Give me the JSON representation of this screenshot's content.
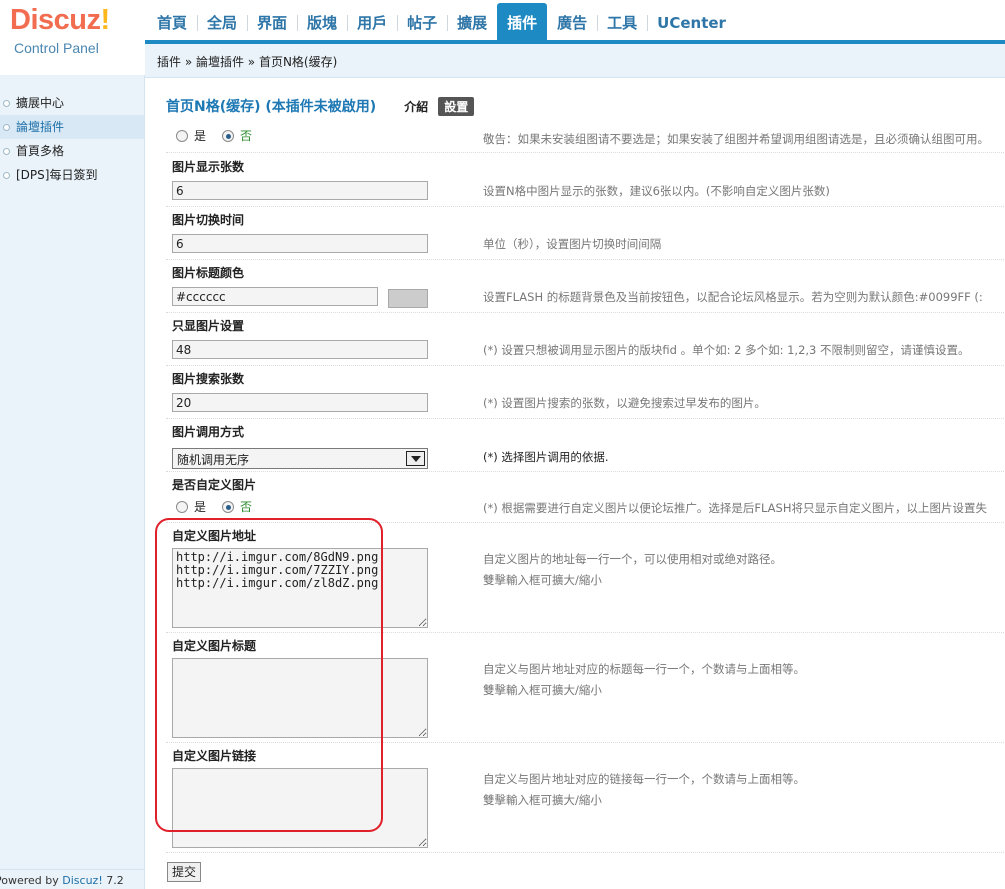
{
  "header": {
    "logo_text": "Discuz",
    "logo_bang": "!",
    "logo_sub": "Control Panel",
    "nav": [
      "首頁",
      "全局",
      "界面",
      "版塊",
      "用戶",
      "帖子",
      "擴展",
      "插件",
      "廣告",
      "工具",
      "UCenter"
    ],
    "active_nav": "插件",
    "breadcrumb": "插件 » 論壇插件 » 首页N格(缓存)"
  },
  "sidebar": {
    "items": [
      "擴展中心",
      "論壇插件",
      "首頁多格",
      "[DPS]每日簽到"
    ],
    "active": "論壇插件",
    "powered_prefix": "Powered by ",
    "powered_brand": "Discuz!",
    "powered_version": " 7.2"
  },
  "main": {
    "title": "首页N格(缓存) (本插件未被啟用)",
    "intro_label": "介紹",
    "settings_label": "設置",
    "top_row": {
      "opt_yes": "是",
      "opt_no": "否",
      "desc": "敬告：如果未安装组图请不要选是；如果安装了组图并希望调用组图请选是，且必须确认组图可用。"
    },
    "fields": [
      {
        "label": "图片显示张数",
        "value": "6",
        "desc": "设置N格中图片显示的张数，建议6张以内。(不影响自定义图片张数)"
      },
      {
        "label": "图片切换时间",
        "value": "6",
        "desc": "单位（秒），设置图片切换时间间隔"
      },
      {
        "label": "图片标题颜色",
        "value": "#cccccc",
        "swatch": "#cccccc",
        "desc": "设置FLASH 的标题背景色及当前按钮色，以配合论坛风格显示。若为空则为默认颜色:#0099FF (:"
      },
      {
        "label": "只显图片设置",
        "value": "48",
        "desc": "(*) 设置只想被调用显示图片的版块fid 。单个如:  2 多个如: 1,2,3 不限制则留空，请谨慎设置。"
      },
      {
        "label": "图片搜索张数",
        "value": "20",
        "desc": "(*) 设置图片搜索的张数，以避免搜索过早发布的图片。"
      }
    ],
    "select_field": {
      "label": "图片调用方式",
      "value": "随机调用无序",
      "desc": "(*) 选择图片调用的依据."
    },
    "custom_toggle": {
      "label": "是否自定义图片",
      "opt_yes": "是",
      "opt_no": "否",
      "desc": "(*) 根据需要进行自定义图片以便论坛推广。选择是后FLASH将只显示自定义图片，以上图片设置失"
    },
    "textareas": [
      {
        "label": "自定义图片地址",
        "value": "http://i.imgur.com/8GdN9.png\nhttp://i.imgur.com/7ZZIY.png\nhttp://i.imgur.com/zl8dZ.png",
        "desc1": "自定义图片的地址每一行一个，可以使用相对或绝对路径。",
        "desc2": "雙擊輸入框可擴大/縮小"
      },
      {
        "label": "自定义图片标题",
        "value": "",
        "desc1": "自定义与图片地址对应的标题每一行一个，个数请与上面相等。",
        "desc2": "雙擊輸入框可擴大/縮小"
      },
      {
        "label": "自定义图片链接",
        "value": "",
        "desc1": "自定义与图片地址对应的链接每一行一个，个数请与上面相等。",
        "desc2": "雙擊輸入框可擴大/縮小"
      }
    ],
    "submit_label": "提交"
  }
}
